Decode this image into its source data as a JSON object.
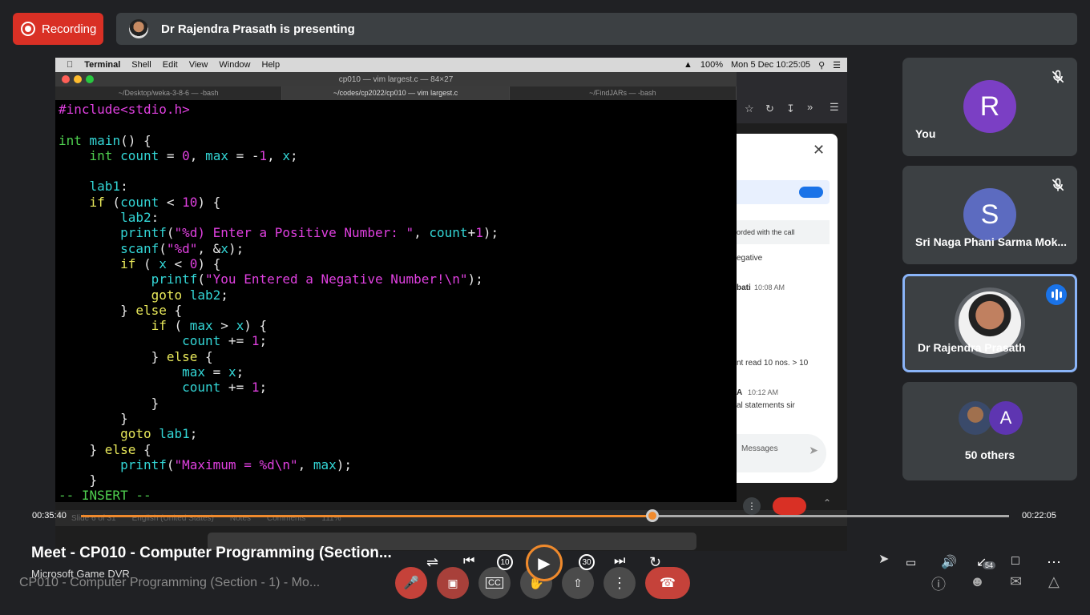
{
  "header": {
    "recording_label": "Recording",
    "presenting_text": "Dr Rajendra Prasath is presenting"
  },
  "mac_menu": {
    "apple": "",
    "app": "Terminal",
    "items": [
      "Shell",
      "Edit",
      "View",
      "Window",
      "Help"
    ],
    "battery": "100%",
    "datetime": "Mon 5 Dec  10:25:05"
  },
  "terminal": {
    "window_title": "cp010 — vim largest.c — 84×27",
    "tabs": [
      "~/Desktop/weka-3-8-6 — -bash",
      "~/codes/cp2022/cp010 — vim largest.c",
      "~/FindJARs — -bash"
    ],
    "code_lines": [
      "#include<stdio.h>",
      "",
      "int main() {",
      "    int count = 0, max = -1, x;",
      "",
      "    lab1:",
      "    if (count < 10) {",
      "        lab2:",
      "        printf(\"%d) Enter a Positive Number: \", count+1);",
      "        scanf(\"%d\", &x);",
      "        if ( x < 0) {",
      "            printf(\"You Entered a Negative Number!\\n\");",
      "            goto lab2;",
      "        } else {",
      "            if ( max > x) {",
      "                count += 1;",
      "            } else {",
      "                max = x;",
      "                count += 1;",
      "            }",
      "        }",
      "        goto lab1;",
      "    } else {",
      "        printf(\"Maximum = %d\\n\", max);",
      "    }",
      "-- INSERT --"
    ],
    "slide_status": "Slide 6 of 31",
    "language": "English (United States)",
    "notes": "Notes",
    "comments": "Comments",
    "zoom": "111%"
  },
  "chat_panel": {
    "note": "orded with the call",
    "line1": "egative",
    "sender1": "bati",
    "time1": "10:08 AM",
    "line2": "nt read 10 nos. > 10",
    "sender2": "A",
    "time2": "10:12 AM",
    "line3": "al statements sir",
    "send_placeholder": "Messages"
  },
  "participants": [
    {
      "name": "You",
      "initial": "R",
      "color": "#7b3fc4"
    },
    {
      "name": "Sri Naga Phani Sarma Mok...",
      "initial": "S",
      "color": "#5c6bc0"
    },
    {
      "name": "Dr Rajendra Prasath",
      "initial": ""
    },
    {
      "name": "50 others",
      "initial": "A",
      "color": "#5e35b1"
    }
  ],
  "player": {
    "elapsed": "00:35:40",
    "remaining": "00:22:05",
    "progress": 0.616,
    "title": "Meet - CP010 - Computer Programming (Section...",
    "subtitle": "Microsoft Game DVR",
    "skip_back": "10",
    "skip_fwd": "30"
  },
  "meet_controls": {
    "meeting_title": "CP010 - Computer Programming (Section - 1) - Mo...",
    "participant_count": "54"
  }
}
